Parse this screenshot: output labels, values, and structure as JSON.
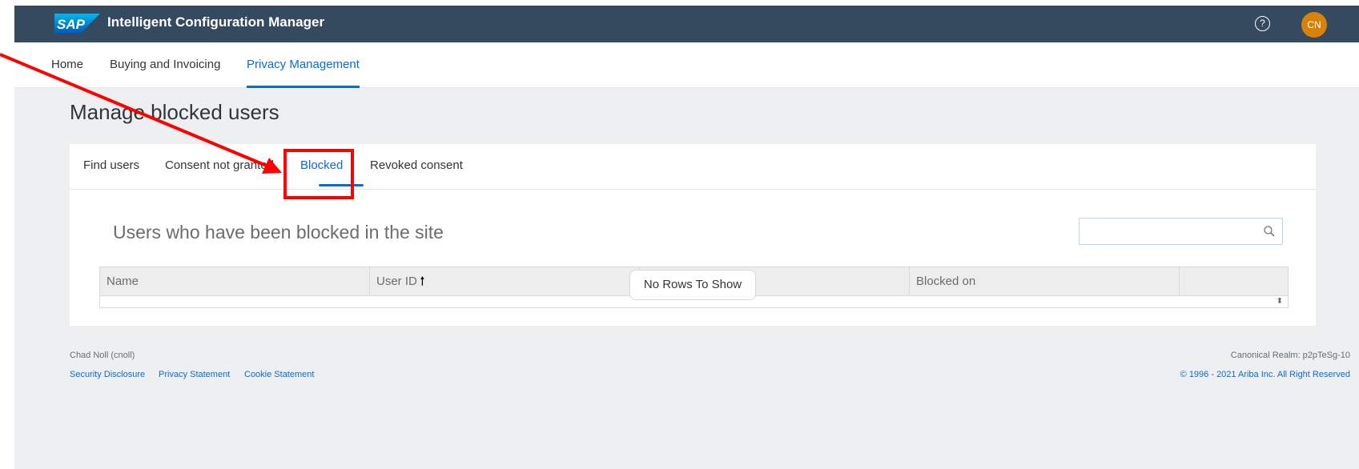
{
  "header": {
    "logo_text": "SAP",
    "app_title": "Intelligent Configuration Manager",
    "help_icon": "question-circle-icon",
    "help_glyph": "?",
    "user_initials": "CN"
  },
  "nav": {
    "items": [
      {
        "label": "Home"
      },
      {
        "label": "Buying and Invoicing"
      },
      {
        "label": "Privacy Management",
        "active": true
      }
    ]
  },
  "page": {
    "title": "Manage blocked users",
    "tabs": [
      {
        "label": "Find users"
      },
      {
        "label": "Consent not granted"
      },
      {
        "label": "Blocked",
        "active": true
      },
      {
        "label": "Revoked consent"
      }
    ],
    "section_title": "Users who have been blocked in the site",
    "search": {
      "placeholder": "",
      "value": "",
      "icon": "search-icon"
    },
    "table": {
      "columns": [
        {
          "label": "Name"
        },
        {
          "label": "User ID",
          "sort": "ascending",
          "sort_glyph": "🠑"
        },
        {
          "label": ""
        },
        {
          "label": "Blocked on"
        }
      ],
      "rows": [],
      "empty_message": "No Rows To Show",
      "scroll_glyph": "⬍"
    }
  },
  "footer": {
    "user": "Chad Noll (cnoll)",
    "links": [
      "Security Disclosure",
      "Privacy Statement",
      "Cookie Statement"
    ],
    "realm": "Canonical Realm: p2pTeSg-10",
    "copyright": "© 1996 - 2021 Ariba Inc. All Right Reserved"
  },
  "colors": {
    "shellbar": "#354a5f",
    "accent": "#0a6ed1",
    "avatar": "#d7820b",
    "annotation": "#ff0000",
    "page_background": "#edeff0"
  }
}
